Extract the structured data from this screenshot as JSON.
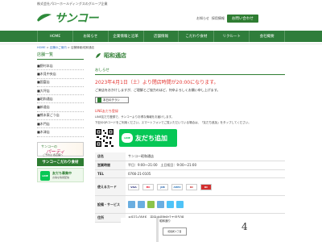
{
  "header": {
    "company_line": "株式会社パローホールディングスのグループ企業",
    "logo_text": "サンコー",
    "links": [
      "お知らせ",
      "採用情報"
    ],
    "contact_label": "お問い合わせ"
  },
  "nav": {
    "items": [
      "HOME",
      "お知らせ",
      "企業情報と沿革",
      "店舗情報",
      "こだわり食材",
      "リクルート",
      "会社概要"
    ]
  },
  "breadcrumb": {
    "home": "HOME",
    "store_list": "店舗のご案内",
    "current": "店舗情報/昭和通店"
  },
  "sidebar": {
    "heading": "店舗一覧",
    "stores": [
      "■野村本店",
      "■木見中央店",
      "■国富店",
      "■大坪店",
      "■昭和通店",
      "■新道店",
      "■熊本東ごう店",
      "■木門店",
      "■木津店"
    ],
    "banner1": {
      "top": "サンコーの",
      "main": "パーティ",
      "sub": "ご予約は 各店舗へ"
    },
    "banner2": "サンコーこだわり食材",
    "banner3": {
      "badge": "LINE",
      "title": "友だち募集中",
      "sub": "お得な情報配信"
    }
  },
  "main": {
    "store_name": "昭和通店",
    "notice_heading": "おしらせ",
    "notice_red": "2023年4月1日（土）より閉店時間が20:00になります。",
    "notice_body": "ご来店をおかけしますが、ご理解とご協力のほど、何卒よろしくお願い申し上げます。",
    "chirashi_label": "本日のチラシ",
    "line_heading": "LINE友だち登録",
    "line_body": [
      "LINE友だち登録で、サンコーよりお得な情報をお届けします。",
      "下記のQRコードをご利用ください。スマートフォンでご覧いただいている場合は、「友だち追加」をタップしてください。"
    ],
    "line_button": "友だち追加",
    "line_button_icon_text": "LINE",
    "info": {
      "rows": [
        {
          "key": "店名",
          "value": "サンコー昭和通店"
        },
        {
          "key": "営業時間",
          "value": "平日：9:00～21:00　土日祝日：9:00～21:00"
        },
        {
          "key": "TEL",
          "value": "0766-21-0105"
        },
        {
          "key": "使えるカード",
          "value": ""
        },
        {
          "key": "設備・サービス",
          "value": ""
        },
        {
          "key": "住所",
          "value": "〒933-0046　高岡市昭和町1丁目508"
        }
      ],
      "cards": [
        "VISA",
        "MC",
        "JCB",
        "AMEX",
        "DC",
        "DC"
      ]
    },
    "map": {
      "label": "昭和通り",
      "pin": "昭和町1丁目",
      "number": "4"
    }
  },
  "colors": {
    "brand_green": "#2e7d32",
    "nav_green": "#2f7d3b",
    "notice_red": "#e53935",
    "line_green": "#06c755"
  }
}
